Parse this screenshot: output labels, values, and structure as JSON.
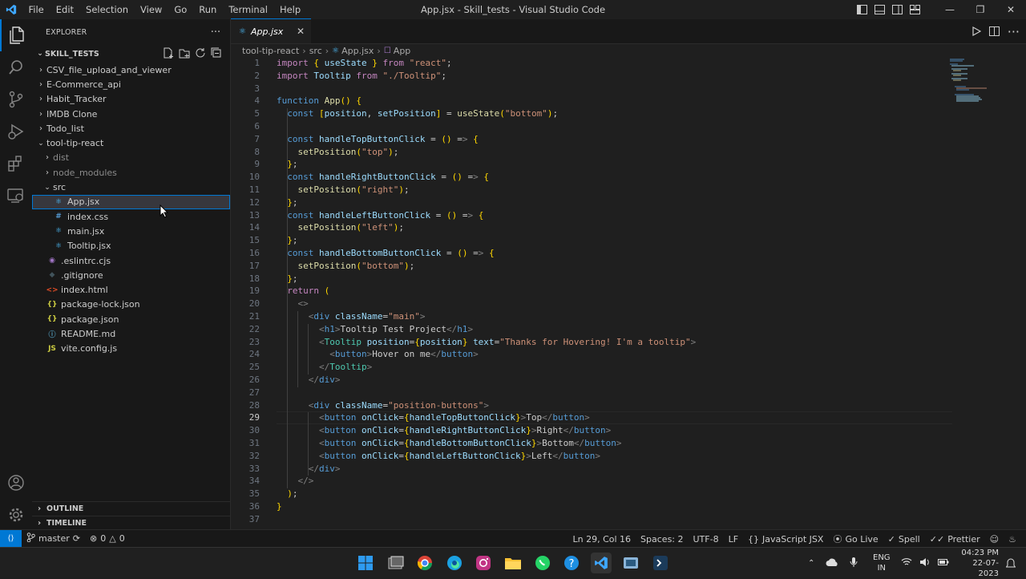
{
  "titlebar": {
    "menu": [
      "File",
      "Edit",
      "Selection",
      "View",
      "Go",
      "Run",
      "Terminal",
      "Help"
    ],
    "title": "App.jsx - Skill_tests - Visual Studio Code"
  },
  "activity_bar": [
    "explorer-icon",
    "search-icon",
    "source-control-icon",
    "run-debug-icon",
    "extensions-icon",
    "remote-explorer-icon",
    "account-icon",
    "settings-gear-icon"
  ],
  "sidebar": {
    "header": "EXPLORER",
    "project": "SKILL_TESTS",
    "tree": [
      {
        "label": "CSV_file_upload_and_viewer",
        "type": "folder"
      },
      {
        "label": "E-Commerce_api",
        "type": "folder"
      },
      {
        "label": "Habit_Tracker",
        "type": "folder"
      },
      {
        "label": "IMDB Clone",
        "type": "folder"
      },
      {
        "label": "Todo_list",
        "type": "folder"
      },
      {
        "label": "tool-tip-react",
        "type": "folder-open"
      },
      {
        "label": "dist",
        "type": "folder"
      },
      {
        "label": "node_modules",
        "type": "folder"
      },
      {
        "label": "src",
        "type": "folder-open"
      },
      {
        "label": "App.jsx",
        "type": "file"
      },
      {
        "label": "index.css",
        "type": "file"
      },
      {
        "label": "main.jsx",
        "type": "file"
      },
      {
        "label": "Tooltip.jsx",
        "type": "file"
      },
      {
        "label": ".eslintrc.cjs",
        "type": "file"
      },
      {
        "label": ".gitignore",
        "type": "file"
      },
      {
        "label": "index.html",
        "type": "file"
      },
      {
        "label": "package-lock.json",
        "type": "file"
      },
      {
        "label": "package.json",
        "type": "file"
      },
      {
        "label": "README.md",
        "type": "file"
      },
      {
        "label": "vite.config.js",
        "type": "file"
      }
    ],
    "icons": {
      "jsx": "⚛",
      "css": "#",
      "cjs": "◉",
      "gitignore": "◆",
      "html": "<>",
      "json": "{}",
      "md": "ⓘ",
      "js": "JS"
    },
    "outline": "OUTLINE",
    "timeline": "TIMELINE"
  },
  "editor": {
    "tab": "App.jsx",
    "breadcrumb": [
      "tool-tip-react",
      "src",
      "App.jsx",
      "App"
    ],
    "lines": [
      "import { useState } from \"react\";",
      "import Tooltip from \"./Tooltip\";",
      "",
      "function App() {",
      "  const [position, setPosition] = useState(\"bottom\");",
      "",
      "  const handleTopButtonClick = () => {",
      "    setPosition(\"top\");",
      "  };",
      "  const handleRightButtonClick = () => {",
      "    setPosition(\"right\");",
      "  };",
      "  const handleLeftButtonClick = () => {",
      "    setPosition(\"left\");",
      "  };",
      "  const handleBottomButtonClick = () => {",
      "    setPosition(\"bottom\");",
      "  };",
      "  return (",
      "    <>",
      "      <div className=\"main\">",
      "        <h1>Tooltip Test Project</h1>",
      "        <Tooltip position={position} text=\"Thanks for Hovering! I'm a tooltip\">",
      "          <button>Hover on me</button>",
      "        </Tooltip>",
      "      </div>",
      "",
      "      <div className=\"position-buttons\">",
      "        <button onClick={handleTopButtonClick}>Top</button>",
      "        <button onClick={handleRightButtonClick}>Right</button>",
      "        <button onClick={handleBottomButtonClick}>Bottom</button>",
      "        <button onClick={handleLeftButtonClick}>Left</button>",
      "      </div>",
      "    </>",
      "  );",
      "}",
      ""
    ],
    "current_line": 29
  },
  "statusbar": {
    "branch": "master",
    "errors": "0",
    "warnings": "0",
    "position": "Ln 29, Col 16",
    "spaces": "Spaces: 2",
    "encoding": "UTF-8",
    "eol": "LF",
    "language": "JavaScript JSX",
    "golive": "Go Live",
    "spell": "Spell",
    "prettier": "Prettier"
  },
  "taskbar": {
    "lang1": "ENG",
    "lang2": "IN",
    "time": "04:23 PM",
    "date": "22-07-2023"
  },
  "colors": {
    "accent": "#0078d4",
    "background": "#1f1f1f",
    "sidebar": "#181818"
  }
}
